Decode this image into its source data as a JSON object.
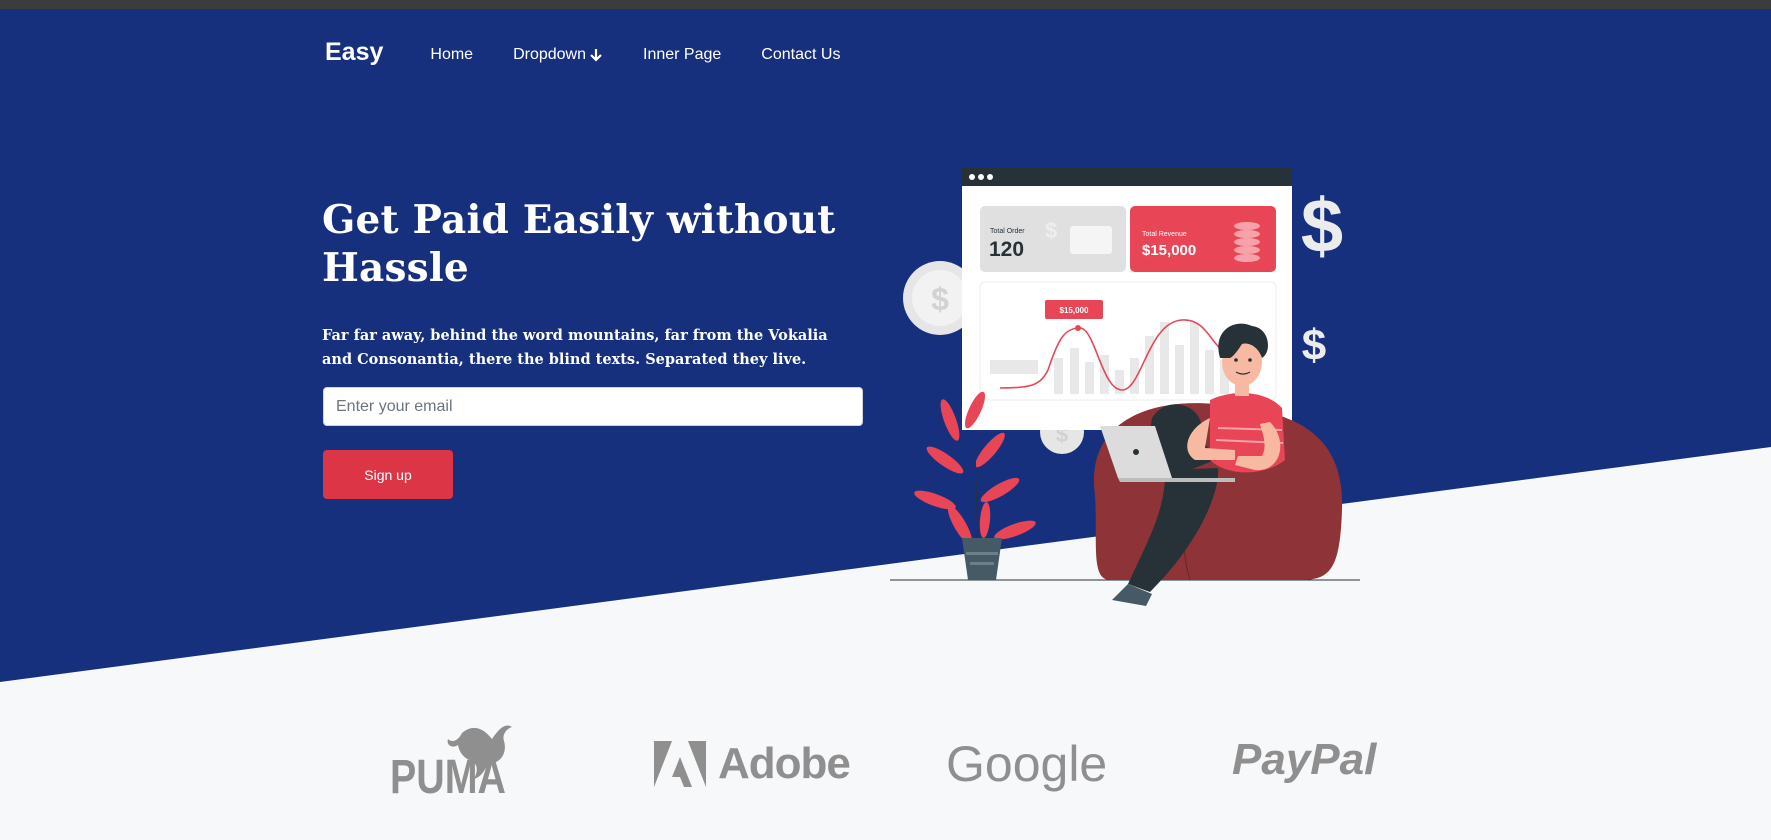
{
  "brand": "Easy",
  "nav": {
    "home": "Home",
    "dropdown": "Dropdown",
    "inner": "Inner Page",
    "contact": "Contact Us"
  },
  "hero": {
    "headline": "Get Paid Easily without Hassle",
    "subtext": "Far far away, behind the word mountains, far from the Vokalia and Consonantia, there the blind texts. Separated they live.",
    "email_placeholder": "Enter your email",
    "signup_label": "Sign up"
  },
  "illustration": {
    "order_label": "Total Order",
    "order_value": "120",
    "revenue_label": "Total Revenue",
    "revenue_value": "$15,000",
    "tooltip": "$15,000",
    "dollar_sign": "$"
  },
  "logos": {
    "puma": "PUMA",
    "adobe": "Adobe",
    "google": "Google",
    "paypal": "PayPal"
  },
  "colors": {
    "hero_blue": "#17307e",
    "accent_red": "#dc3545",
    "light_bg": "#f7f8fa"
  }
}
